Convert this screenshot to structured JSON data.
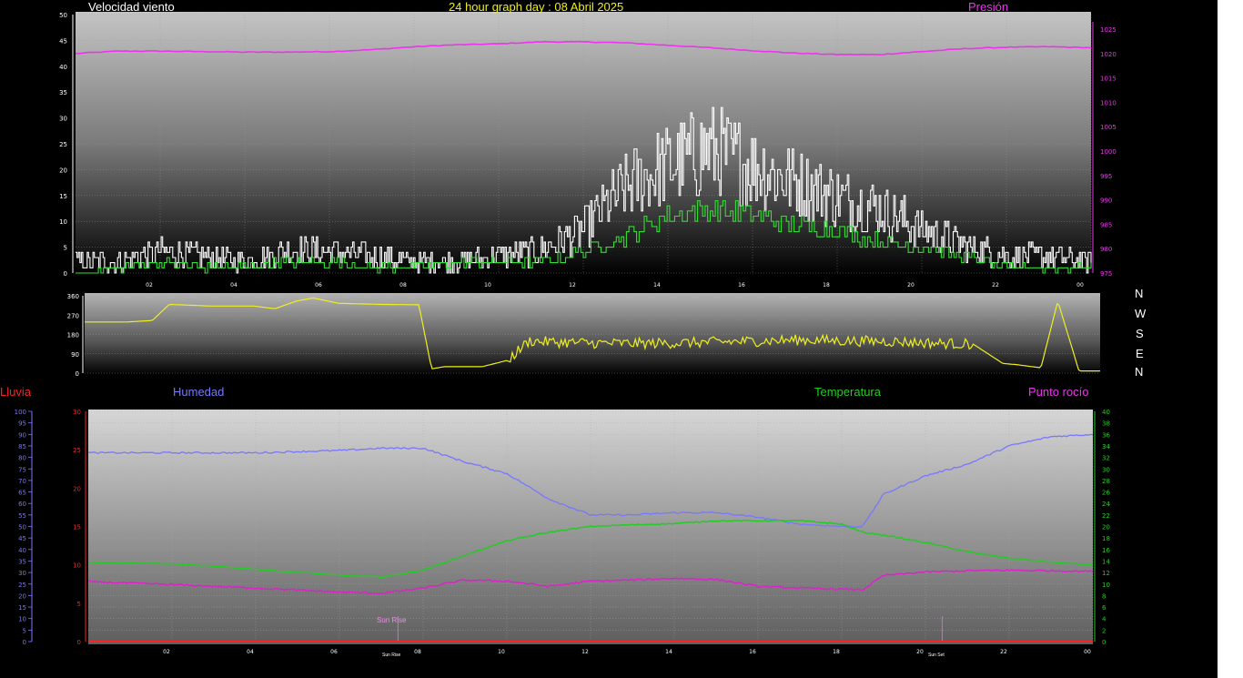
{
  "header": {
    "wind_title": "Velocidad viento",
    "graph_title": "24 hour graph day : 08 Abril 2025",
    "pressure_title": "Presión"
  },
  "compass": [
    "N",
    "W",
    "S",
    "E",
    "N"
  ],
  "legend": {
    "rain": "Lluvia",
    "humidity": "Humedad",
    "temperature": "Temperatura",
    "dewpoint": "Punto rocío"
  },
  "markers": {
    "sunrise": "Sun Rise",
    "sunrise_axis": "Sun Rise",
    "sunset_axis": "Sun Set"
  },
  "colors": {
    "wind_gust": "#ffffff",
    "wind_avg": "#33dd33",
    "pressure": "#ee33ee",
    "direction": "#eeee22",
    "humidity": "#7777ff",
    "temperature": "#22cc22",
    "dewpoint": "#dd22cc",
    "rain": "#ff2222"
  },
  "chart_data": [
    {
      "type": "line",
      "title": "Velocidad viento",
      "x_ticks": [
        "02",
        "04",
        "06",
        "08",
        "10",
        "12",
        "14",
        "16",
        "18",
        "20",
        "22",
        "00"
      ],
      "x_range": [
        0,
        24
      ],
      "ylim": [
        0,
        50
      ],
      "y_ticks": [
        "0",
        "5",
        "10",
        "15",
        "20",
        "25",
        "30",
        "35",
        "40",
        "45",
        "50"
      ],
      "y2lim": [
        975,
        1028
      ],
      "y2_ticks": [
        "975",
        "980",
        "985",
        "990",
        "995",
        "1000",
        "1005",
        "1010",
        "1015",
        "1020",
        "1025"
      ],
      "series": [
        {
          "name": "Presión",
          "axis": "right",
          "x": [
            0,
            1,
            2,
            3,
            4,
            5,
            6,
            7,
            8,
            9,
            10,
            11,
            12,
            13,
            14,
            15,
            16,
            17,
            18,
            19,
            20,
            21,
            22,
            23,
            24
          ],
          "values": [
            1020,
            1020.5,
            1020.5,
            1020.4,
            1020.3,
            1020.3,
            1020.4,
            1020.8,
            1021.4,
            1021.8,
            1022,
            1022.4,
            1022.4,
            1022.2,
            1021.7,
            1021.2,
            1020.6,
            1020.1,
            1019.8,
            1019.8,
            1020.4,
            1021,
            1021.3,
            1021.4,
            1021.2
          ]
        },
        {
          "axis": "left",
          "x": [
            0,
            1,
            2,
            3,
            4,
            5,
            6,
            7,
            8,
            9,
            10,
            11,
            12,
            13,
            14,
            15,
            16,
            17,
            18,
            19,
            20,
            21,
            22,
            23,
            24
          ],
          "values": [
            2,
            2,
            4,
            3,
            2,
            4,
            4,
            3,
            2,
            2,
            3,
            4,
            8,
            16,
            20,
            23,
            20,
            17,
            14,
            12,
            8,
            5,
            3,
            3,
            2
          ]
        },
        {
          "axis": "left",
          "x": [
            0,
            1,
            2,
            3,
            4,
            5,
            6,
            7,
            8,
            9,
            10,
            11,
            12,
            13,
            14,
            15,
            16,
            17,
            18,
            19,
            20,
            21,
            22,
            23,
            24
          ],
          "values": [
            0,
            1,
            2,
            1,
            1,
            2,
            2,
            1,
            1,
            2,
            2,
            2,
            4,
            7,
            11,
            12,
            11,
            9,
            8,
            6,
            5,
            3,
            1,
            1,
            1
          ]
        }
      ]
    },
    {
      "type": "line",
      "x_range": [
        0,
        24
      ],
      "ylim": [
        0,
        360
      ],
      "y_ticks": [
        "0",
        "90",
        "180",
        "270",
        "360"
      ],
      "series": [
        {
          "axis": "left",
          "x": [
            0,
            1,
            1.6,
            2,
            3,
            4,
            4.5,
            5,
            5.4,
            6,
            7,
            7.9,
            8.2,
            8.5,
            9,
            9.4,
            10,
            10.5,
            11,
            12,
            13,
            14,
            15,
            16,
            17,
            18,
            19,
            20,
            21,
            21.7,
            22,
            22.6,
            23,
            23.5,
            24
          ],
          "values": [
            238,
            238,
            245,
            320,
            312,
            312,
            300,
            335,
            350,
            325,
            320,
            318,
            20,
            30,
            30,
            30,
            60,
            150,
            145,
            140,
            138,
            140,
            145,
            150,
            155,
            150,
            148,
            140,
            135,
            45,
            40,
            25,
            335,
            10,
            10
          ]
        }
      ]
    },
    {
      "type": "line",
      "x_ticks": [
        "02",
        "04",
        "06",
        "08",
        "10",
        "12",
        "14",
        "16",
        "18",
        "20",
        "22",
        "00"
      ],
      "x_range": [
        0,
        24
      ],
      "ylim": [
        0,
        30
      ],
      "y_ticks": [
        "0",
        "5",
        "10",
        "15",
        "20",
        "25",
        "30"
      ],
      "y_left_outer": [
        "0",
        "5",
        "10",
        "15",
        "20",
        "25",
        "30",
        "35",
        "40",
        "45",
        "50",
        "55",
        "60",
        "65",
        "70",
        "75",
        "80",
        "85",
        "90",
        "95",
        "100"
      ],
      "y_right": [
        "0",
        "2",
        "4",
        "6",
        "8",
        "10",
        "12",
        "14",
        "16",
        "18",
        "20",
        "22",
        "24",
        "26",
        "28",
        "30",
        "32",
        "34",
        "36",
        "38",
        "40"
      ],
      "series": [
        {
          "name": "Humedad",
          "axis": "left-outer",
          "range": [
            0,
            100
          ],
          "x": [
            0,
            2,
            4,
            6,
            7,
            8,
            9,
            10,
            11,
            12,
            13,
            14,
            15,
            16,
            17,
            18,
            18.5,
            19,
            20,
            21,
            22,
            23,
            24
          ],
          "values": [
            82,
            82,
            82,
            83,
            84,
            84,
            78,
            73,
            62,
            55,
            55,
            56,
            56,
            54,
            51,
            50,
            50,
            64,
            72,
            77,
            85,
            89,
            90
          ]
        },
        {
          "name": "Temperatura",
          "axis": "right",
          "range": [
            0,
            40
          ],
          "x": [
            0,
            2,
            4,
            6,
            7,
            8,
            9,
            10,
            11,
            12,
            13,
            14,
            15,
            16,
            17,
            18,
            18.5,
            19,
            20,
            21,
            22,
            23,
            24
          ],
          "values": [
            13.8,
            13.5,
            12.6,
            11.5,
            11.2,
            12.4,
            15,
            17.5,
            19,
            20,
            20.3,
            20.5,
            21,
            21,
            21,
            20.4,
            19,
            18.5,
            17.2,
            15.6,
            14.5,
            13.8,
            13.3
          ]
        },
        {
          "name": "Punto rocío",
          "axis": "right",
          "range": [
            0,
            40
          ],
          "x": [
            0,
            2,
            4,
            6,
            7,
            8,
            9,
            10,
            11,
            12,
            13,
            14,
            15,
            16,
            17,
            18,
            18.5,
            19,
            20,
            21,
            22,
            23,
            24
          ],
          "values": [
            10.4,
            9.9,
            9.3,
            8.6,
            8.4,
            9.3,
            10.7,
            10.5,
            9.6,
            10.5,
            10.7,
            11,
            10.8,
            9.6,
            9.3,
            9.1,
            9,
            11.5,
            12.1,
            12.3,
            12.4,
            12.3,
            12.2
          ]
        },
        {
          "name": "Lluvia",
          "axis": "left",
          "range": [
            0,
            30
          ],
          "x": [
            0,
            24
          ],
          "values": [
            0,
            0
          ]
        }
      ]
    }
  ]
}
